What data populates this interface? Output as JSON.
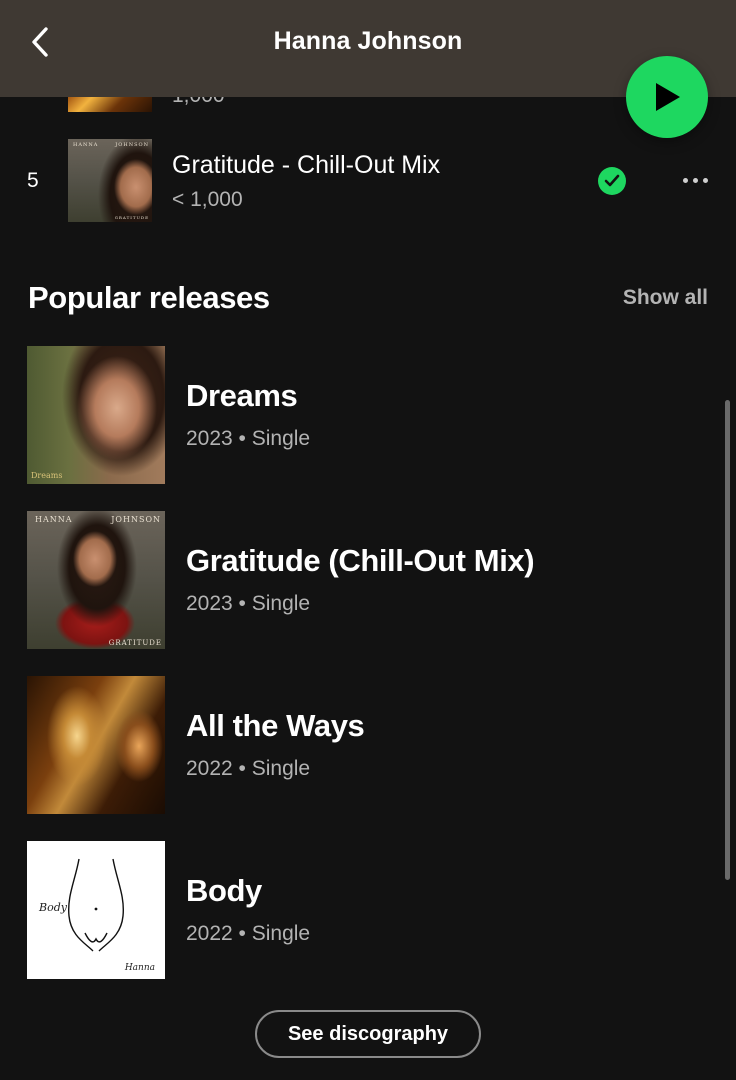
{
  "header": {
    "title": "Hanna Johnson",
    "back_icon": "chevron-left-icon",
    "play_icon": "play-icon"
  },
  "partial_track": {
    "plays": "1,000"
  },
  "track": {
    "number": "5",
    "title": "Gratitude - Chill-Out Mix",
    "plays": "< 1,000",
    "art_text_left": "HANNA",
    "art_text_right": "JOHNSON",
    "art_text_bottom": "GRATITUDE",
    "saved_icon": "check-circle-icon",
    "more_icon": "more-horizontal-icon"
  },
  "popular": {
    "title": "Popular releases",
    "show_all": "Show all",
    "releases": [
      {
        "title": "Dreams",
        "meta": "2023 • Single",
        "art_text": "Dreams"
      },
      {
        "title": "Gratitude (Chill-Out Mix)",
        "meta": "2023 • Single",
        "art_text_left": "HANNA",
        "art_text_right": "JOHNSON",
        "art_text_bottom": "GRATITUDE"
      },
      {
        "title": "All the Ways",
        "meta": "2022 • Single"
      },
      {
        "title": "Body",
        "meta": "2022 • Single",
        "art_text": "Body",
        "art_signature": "Hanna"
      }
    ]
  },
  "discography_button": "See discography",
  "colors": {
    "background": "#121212",
    "header": "#3f3933",
    "accent_green": "#1ed760",
    "text_primary": "#ffffff",
    "text_secondary": "#b3b3b3"
  }
}
